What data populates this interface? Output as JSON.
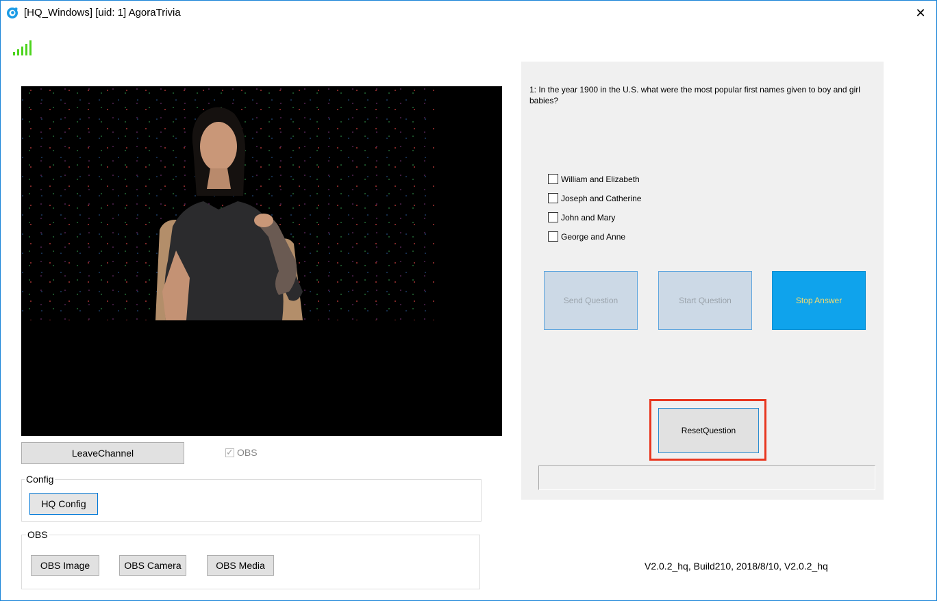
{
  "window": {
    "title": "[HQ_Windows] [uid: 1] AgoraTrivia",
    "close_glyph": "✕",
    "accent_color": "#1883d7"
  },
  "signal": {
    "icon": "signal-strength-icon",
    "color": "#4cd41c",
    "bars": 5
  },
  "video": {
    "background": "#000000",
    "content": "host-video"
  },
  "controls": {
    "leave_label": "LeaveChannel",
    "obs_label": "OBS",
    "obs_checked": true
  },
  "config_group": {
    "label": "Config",
    "button_label": "HQ Config"
  },
  "obs_group": {
    "label": "OBS",
    "buttons": [
      "OBS Image",
      "OBS Camera",
      "OBS Media"
    ]
  },
  "question_panel": {
    "question": "1: In the year 1900 in the U.S. what were the most popular first names given to boy and girl babies?",
    "answers": [
      "William and Elizabeth",
      "Joseph and Catherine",
      "John and Mary",
      "George and Anne"
    ],
    "buttons": {
      "send": "Send Question",
      "start": "Start Question",
      "stop": "Stop Answer",
      "reset": "ResetQuestion"
    },
    "status_text": ""
  },
  "version": "V2.0.2_hq, Build210, 2018/8/10, V2.0.2_hq"
}
